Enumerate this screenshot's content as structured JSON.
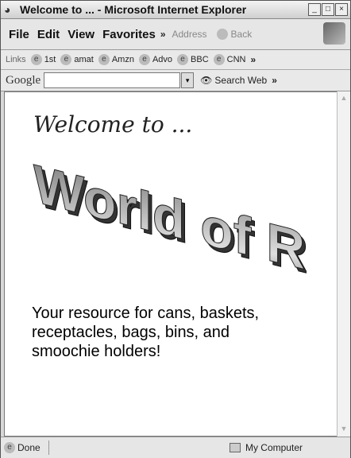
{
  "window": {
    "title": "Welcome to ... - Microsoft Internet Explorer"
  },
  "menubar": {
    "items": [
      "File",
      "Edit",
      "View",
      "Favorites"
    ],
    "chevron": "»",
    "address_label": "Address",
    "back_label": "Back"
  },
  "links": {
    "label": "Links",
    "items": [
      "1st",
      "amat",
      "Amzn",
      "Advo",
      "BBC",
      "CNN"
    ],
    "chevron": "»"
  },
  "google": {
    "logo": "Google",
    "search_value": "",
    "search_button": "Search Web",
    "chevron": "»"
  },
  "content": {
    "welcome": "Welcome to ...",
    "word_art_text": "World of Rubbish!",
    "tagline": "Your resource for cans, baskets, receptacles, bags, bins, and smoochie holders!"
  },
  "status": {
    "left": "Done",
    "right": "My Computer"
  }
}
